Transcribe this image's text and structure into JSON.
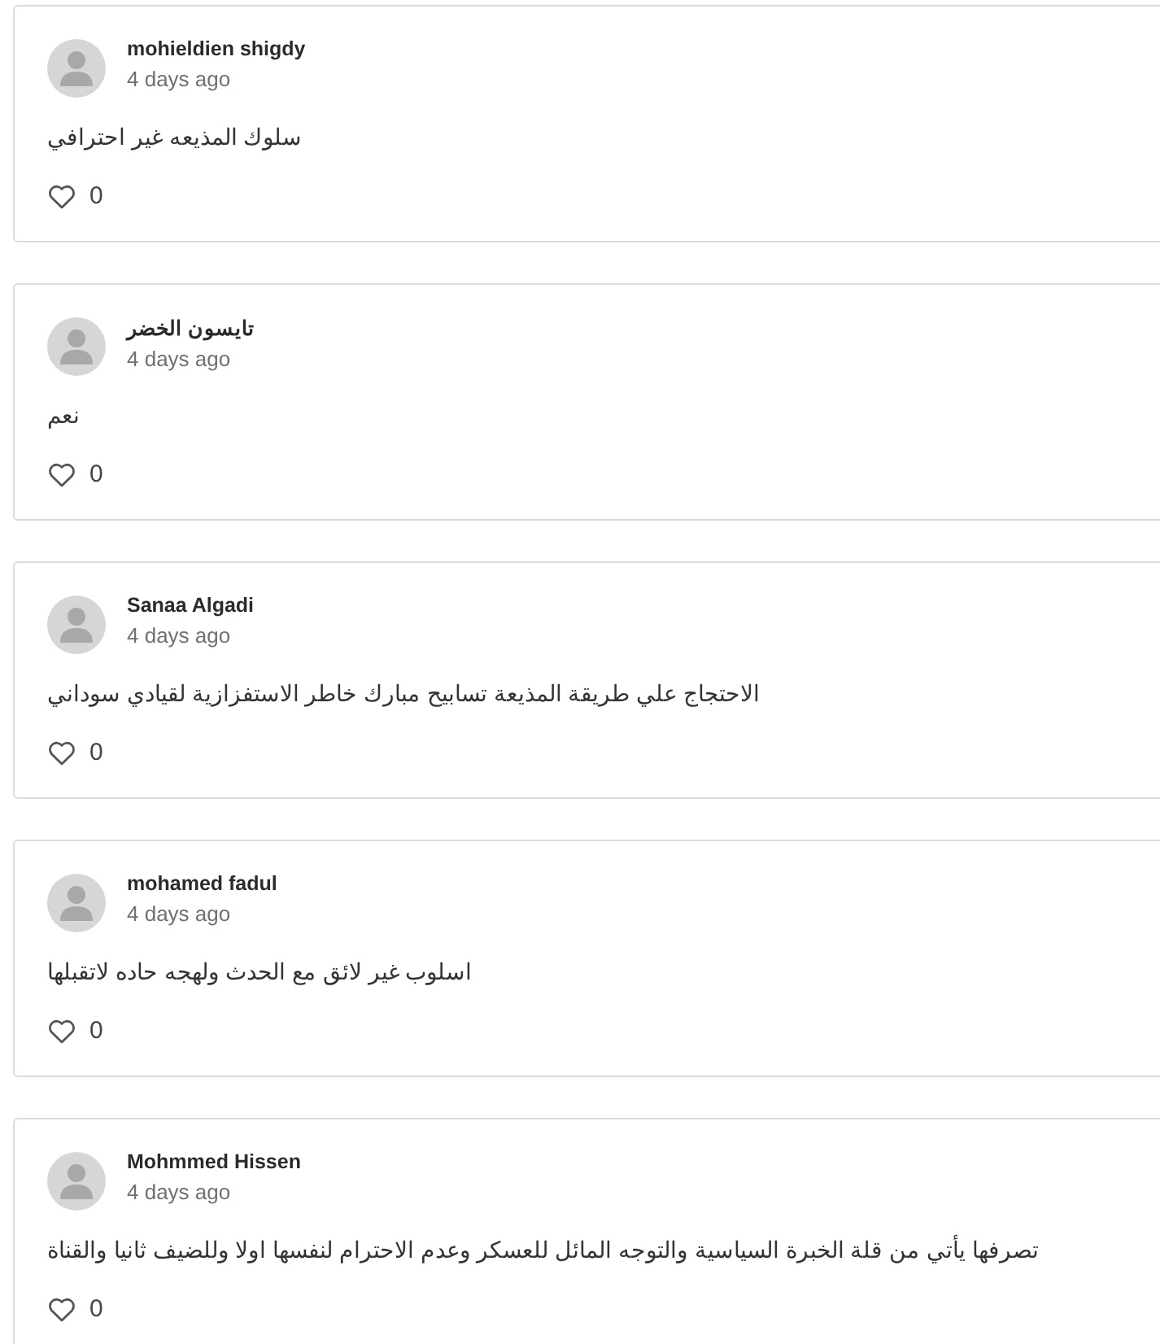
{
  "comments": [
    {
      "author": "mohieldien shigdy",
      "time": "4 days ago",
      "text": "سلوك المذيعه غير احترافي",
      "likes": "0"
    },
    {
      "author": "تايسون الخضر",
      "time": "4 days ago",
      "text": "نعم",
      "likes": "0"
    },
    {
      "author": "Sanaa Algadi",
      "time": "4 days ago",
      "text": "الاحتجاج علي طريقة المذيعة تسابيح مبارك خاطر الاستفزازية لقيادي سوداني",
      "likes": "0"
    },
    {
      "author": "mohamed fadul",
      "time": "4 days ago",
      "text": "اسلوب غير لائق مع الحدث ولهجه حاده لاتقبلها",
      "likes": "0"
    },
    {
      "author": "Mohmmed Hissen",
      "time": "4 days ago",
      "text": "تصرفها يأتي من قلة الخبرة السياسية والتوجه المائل للعسكر وعدم الاحترام لنفسها اولا وللضيف ثانيا والقناة",
      "likes": "0"
    }
  ]
}
